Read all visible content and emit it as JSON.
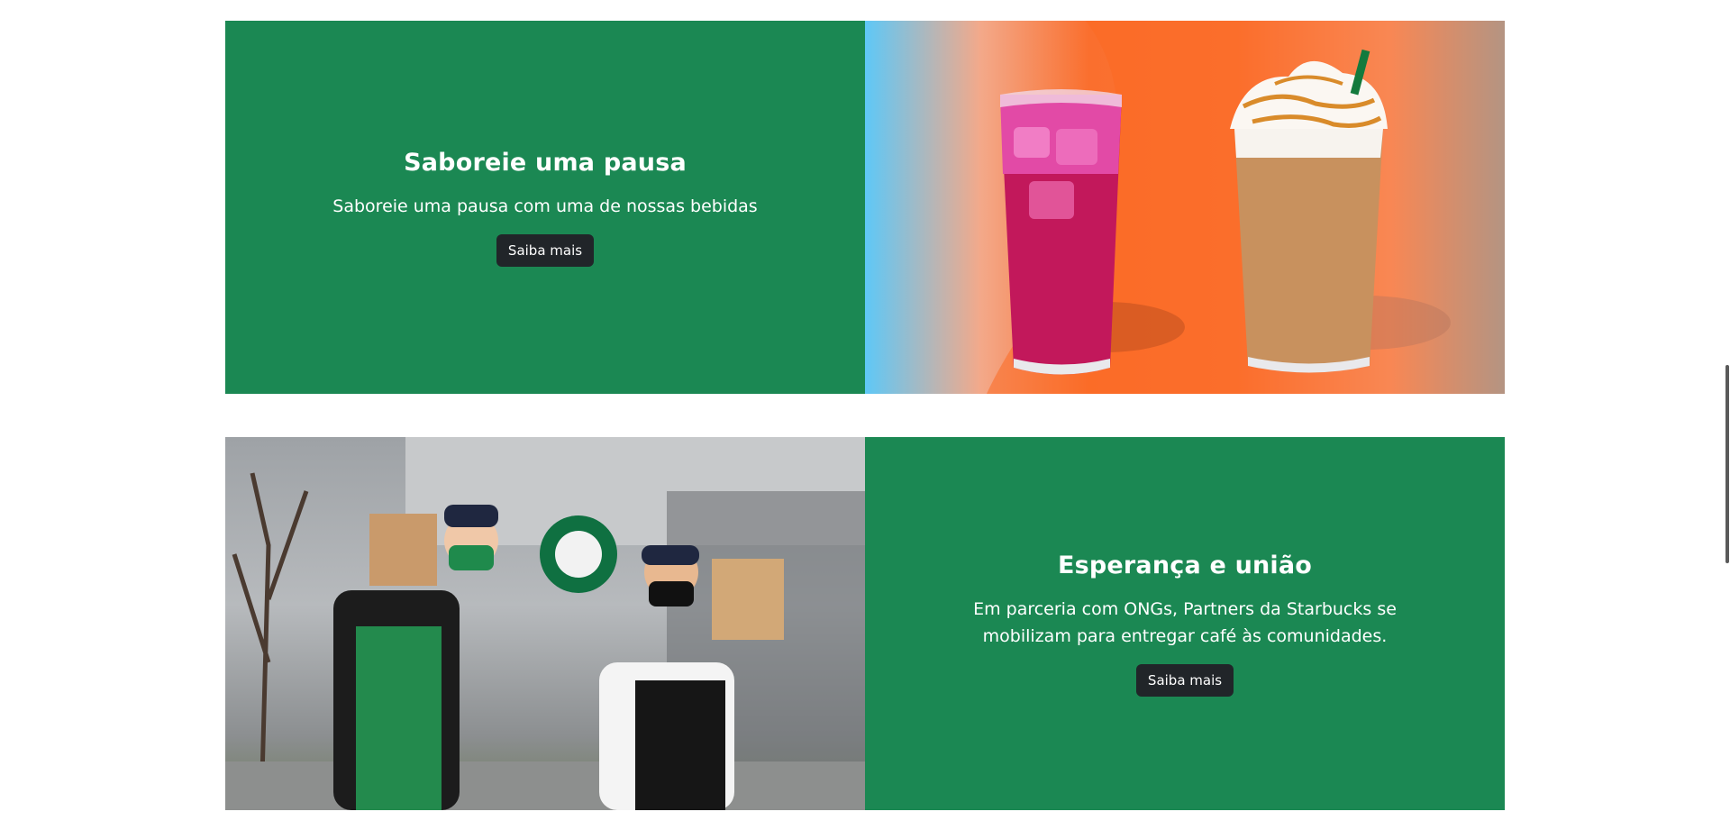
{
  "sections": [
    {
      "title": "Saboreie uma pausa",
      "text": "Saboreie uma pausa com uma de nossas bebidas",
      "button_label": "Saiba mais",
      "image": "iced-drink-and-frappuccino-image"
    },
    {
      "title": "Esperança e união",
      "text": "Em parceria com ONGs, Partners da Starbucks se mobilizam para entregar café às comunidades.",
      "button_label": "Saiba mais",
      "image": "starbucks-partners-with-coffee-boxes-image"
    }
  ],
  "colors": {
    "panel_green": "#1b8853",
    "button_dark": "#212529",
    "text_white": "#ffffff"
  }
}
